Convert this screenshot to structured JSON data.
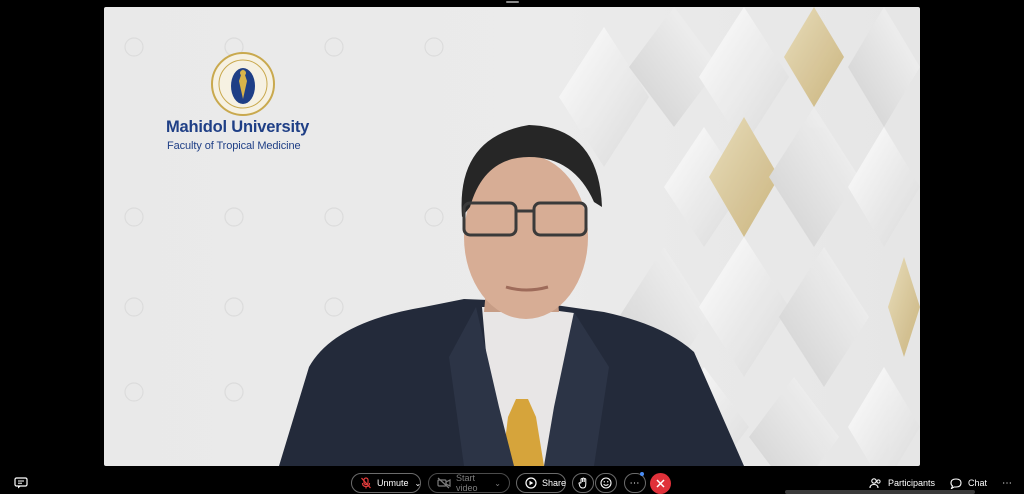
{
  "meeting": {
    "background_logo": {
      "name": "Mahidol University",
      "faculty": "Faculty of Tropical Medicine"
    }
  },
  "toolbar": {
    "unmute_label": "Unmute",
    "start_video_label": "Start video",
    "share_label": "Share",
    "participants_label": "Participants",
    "chat_label": "Chat"
  },
  "colors": {
    "brand_blue": "#1f3f86",
    "end_call_red": "#e0313a",
    "mute_red": "#e23b3b",
    "gold_accent": "#d8c594"
  },
  "icons": {
    "captions": "captions-icon",
    "mic": "mic-off-icon",
    "video": "video-off-icon",
    "share": "share-icon",
    "raise_hand": "hand-icon",
    "reactions": "smiley-icon",
    "more": "more-icon",
    "end": "close-icon",
    "participants": "people-icon",
    "chat": "chat-icon"
  }
}
